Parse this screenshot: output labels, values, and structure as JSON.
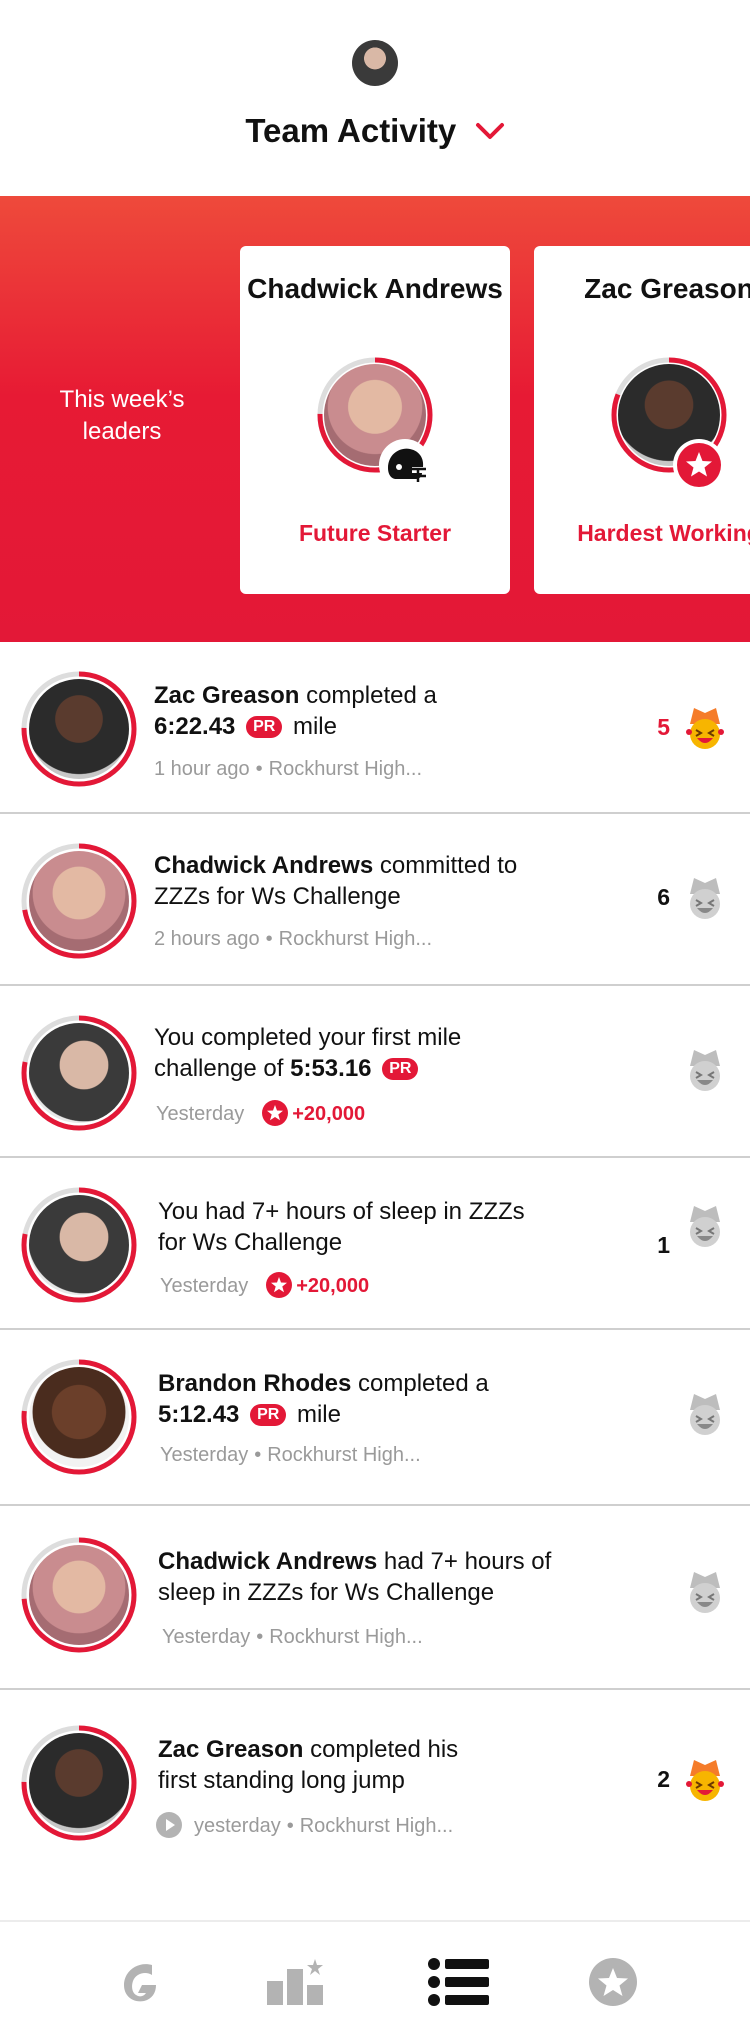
{
  "header": {
    "title": "Team Activity"
  },
  "leaders": {
    "label": "This week’s leaders",
    "cards": [
      {
        "name": "Chadwick Andrews",
        "award": "Future Starter",
        "badge_icon": "football-helmet-icon"
      },
      {
        "name": "Zac Greason",
        "award": "Hardest Working",
        "badge_icon": "star-badge-icon"
      }
    ]
  },
  "feed": [
    {
      "name": "Zac Greason",
      "text_after": "completed a",
      "value": "6:22.43",
      "pr": "PR",
      "text_end": "mile",
      "time": "1 hour ago",
      "school": "Rockhurst High...",
      "count": "5",
      "reaction_active": true
    },
    {
      "name": "Chadwick Andrews",
      "text_after": "committed to ZZZs for Ws Challenge",
      "time": "2 hours ago",
      "school": "Rockhurst High...",
      "count": "6",
      "reaction_active": false
    },
    {
      "text": "You completed your first mile challenge of",
      "value": "5:53.16",
      "pr": "PR",
      "time": "Yesterday",
      "points": "+20,000",
      "count": "",
      "reaction_active": false
    },
    {
      "text": "You had 7+ hours of sleep in ZZZs for Ws Challenge",
      "time": "Yesterday",
      "points": "+20,000",
      "count": "1",
      "reaction_active": false
    },
    {
      "name": "Brandon Rhodes",
      "text_after": "completed a",
      "value": "5:12.43",
      "pr": "PR",
      "text_end": "mile",
      "time": "Yesterday",
      "school": "Rockhurst High...",
      "count": "",
      "reaction_active": false
    },
    {
      "name": "Chadwick Andrews",
      "text_after": "had 7+ hours of sleep in ZZZs for Ws Challenge",
      "time": "Yesterday",
      "school": "Rockhurst High...",
      "count": "",
      "reaction_active": false
    },
    {
      "name": "Zac Greason",
      "text_after": "completed his first standing long jump",
      "time": "yesterday",
      "school": "Rockhurst High...",
      "count": "2",
      "reaction_active": true
    }
  ],
  "nav": [
    "gatorade-icon",
    "leaderboard-icon",
    "activity-list-icon",
    "rewards-star-icon"
  ],
  "colors": {
    "accent": "#e31837",
    "text": "#111111",
    "muted": "#9a9a9a",
    "inactive_icon": "#b3b3b3"
  }
}
